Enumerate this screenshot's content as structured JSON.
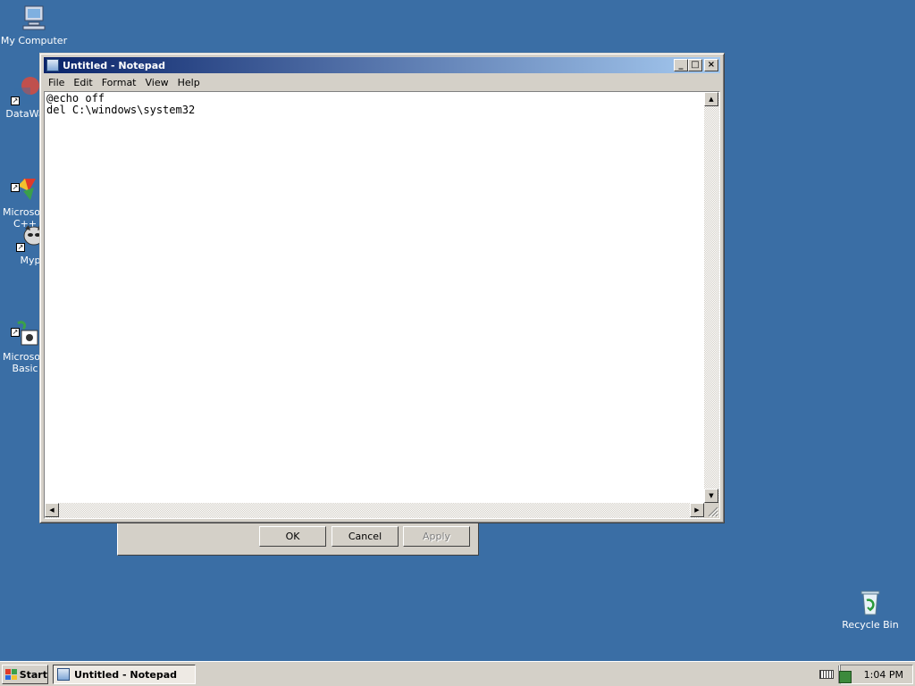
{
  "desktop": {
    "icons": [
      {
        "label": "My Computer",
        "icon": "my-computer-icon"
      },
      {
        "label": "DataWa",
        "icon": "datawarehouse-icon"
      },
      {
        "label": "Microsoft\nC++",
        "icon": "visual-cpp-icon"
      },
      {
        "label": "Myp",
        "icon": "raccoon-icon"
      },
      {
        "label": "Microsoft\nBasic",
        "icon": "visual-basic-icon"
      },
      {
        "label": "Recycle Bin",
        "icon": "recycle-bin-icon"
      }
    ]
  },
  "notepad": {
    "title": "Untitled - Notepad",
    "menu": [
      "File",
      "Edit",
      "Format",
      "View",
      "Help"
    ],
    "text": "@echo off\ndel C:\\windows\\system32"
  },
  "dialog": {
    "ok_label": "OK",
    "cancel_label": "Cancel",
    "apply_label": "Apply"
  },
  "taskbar": {
    "start_label": "Start",
    "task_label": "Untitled - Notepad",
    "clock": "1:04 PM"
  },
  "colors": {
    "desktop": "#3a6ea5",
    "title_active_start": "#0a246a",
    "title_active_end": "#a6caf0",
    "face": "#d4d0c8"
  }
}
